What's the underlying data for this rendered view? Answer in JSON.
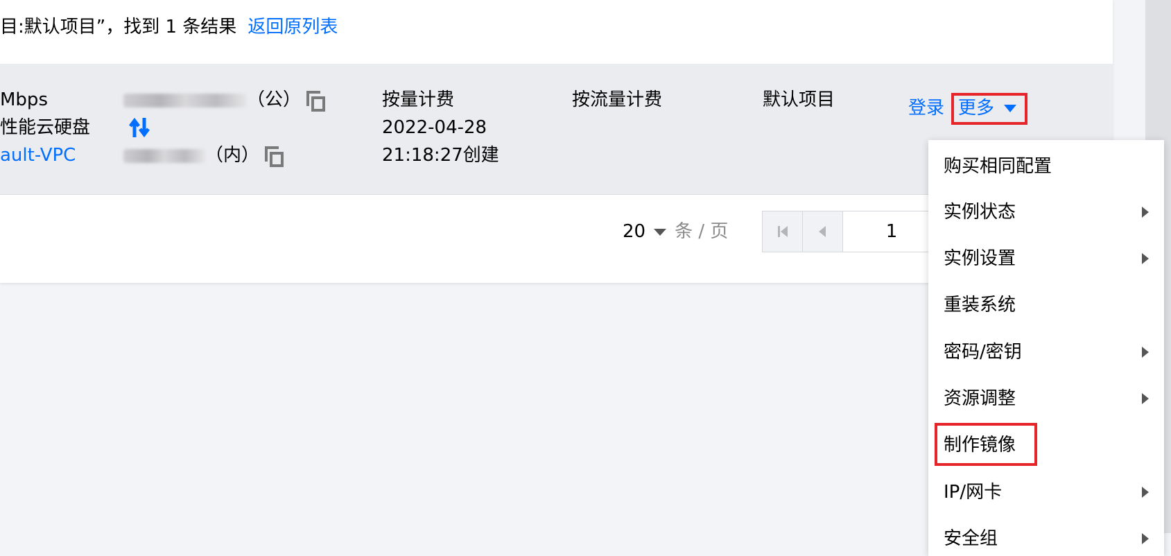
{
  "search": {
    "result_text": "目:默认项目”，找到 1 条结果",
    "back_link": "返回原列表"
  },
  "row": {
    "bandwidth": "Mbps",
    "disk": "性能云硬盘",
    "vpc": "ault-VPC",
    "ip_public_suffix": "（公）",
    "ip_private_suffix": "（内）",
    "billing": "按量计费",
    "created_date": "2022-04-28",
    "created_time": "21:18:27创建",
    "network_billing": "按流量计费",
    "project": "默认项目",
    "login": "登录",
    "more": "更多"
  },
  "pager": {
    "page_size": "20",
    "page_size_unit": "条 / 页",
    "current_page": "1"
  },
  "menu": {
    "items": [
      {
        "label": "购买相同配置"
      },
      {
        "label": "实例状态"
      },
      {
        "label": "实例设置"
      },
      {
        "label": "重装系统"
      },
      {
        "label": "密码/密钥"
      },
      {
        "label": "资源调整"
      },
      {
        "label": "制作镜像"
      },
      {
        "label": "IP/网卡"
      },
      {
        "label": "安全组"
      }
    ]
  },
  "colors": {
    "link": "#006eff",
    "highlight": "#e5252a"
  },
  "icons": [
    "copy-icon",
    "swap-icon",
    "caret-down-icon",
    "first-page-icon",
    "prev-page-icon",
    "chevron-right-icon"
  ]
}
